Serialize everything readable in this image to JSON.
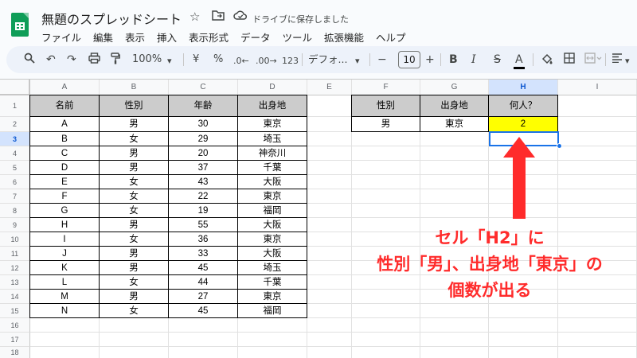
{
  "app": {
    "doc_title": "無題のスプレッドシート",
    "save_status": "ドライブに保存しました",
    "menus": [
      "ファイル",
      "編集",
      "表示",
      "挿入",
      "表示形式",
      "データ",
      "ツール",
      "拡張機能",
      "ヘルプ"
    ]
  },
  "toolbar": {
    "zoom": "100%",
    "currency": "¥",
    "percent": "%",
    "dec_decrease": ".0←",
    "dec_increase": ".00→",
    "number_format": "123",
    "font_name": "デフォ...",
    "font_size": "10",
    "minus": "−",
    "plus": "+",
    "bold": "B",
    "italic": "I",
    "strike": "S",
    "text_color": "A"
  },
  "grid": {
    "columns": [
      "A",
      "B",
      "C",
      "D",
      "E",
      "F",
      "G",
      "H",
      "I"
    ],
    "selected_column": "H",
    "rows": [
      "1",
      "2",
      "3",
      "4",
      "5",
      "6",
      "7",
      "8",
      "9",
      "10",
      "11",
      "12",
      "13",
      "14",
      "15",
      "16",
      "17",
      "18"
    ],
    "selected_row": "3",
    "table1_headers": [
      "名前",
      "性別",
      "年齢",
      "出身地"
    ],
    "table1_rows": [
      [
        "A",
        "男",
        "30",
        "東京"
      ],
      [
        "B",
        "女",
        "29",
        "埼玉"
      ],
      [
        "C",
        "男",
        "20",
        "神奈川"
      ],
      [
        "D",
        "男",
        "37",
        "千葉"
      ],
      [
        "E",
        "女",
        "43",
        "大阪"
      ],
      [
        "F",
        "女",
        "22",
        "東京"
      ],
      [
        "G",
        "女",
        "19",
        "福岡"
      ],
      [
        "H",
        "男",
        "55",
        "大阪"
      ],
      [
        "I",
        "女",
        "36",
        "東京"
      ],
      [
        "J",
        "男",
        "33",
        "大阪"
      ],
      [
        "K",
        "男",
        "45",
        "埼玉"
      ],
      [
        "L",
        "女",
        "44",
        "千葉"
      ],
      [
        "M",
        "男",
        "27",
        "東京"
      ],
      [
        "N",
        "女",
        "45",
        "福岡"
      ]
    ],
    "table2_headers": [
      "性別",
      "出身地",
      "何人？"
    ],
    "table2_row": [
      "男",
      "東京",
      "2"
    ]
  },
  "annotation": {
    "line1": "セル「H2」に",
    "line2": "性別「男」、出身地「東京」の",
    "line3": "個数が出る"
  },
  "colors": {
    "header_fill": "#cccccc",
    "highlight_fill": "#ffff00",
    "selection": "#1a73e8",
    "annotation": "#ff2b2b"
  }
}
